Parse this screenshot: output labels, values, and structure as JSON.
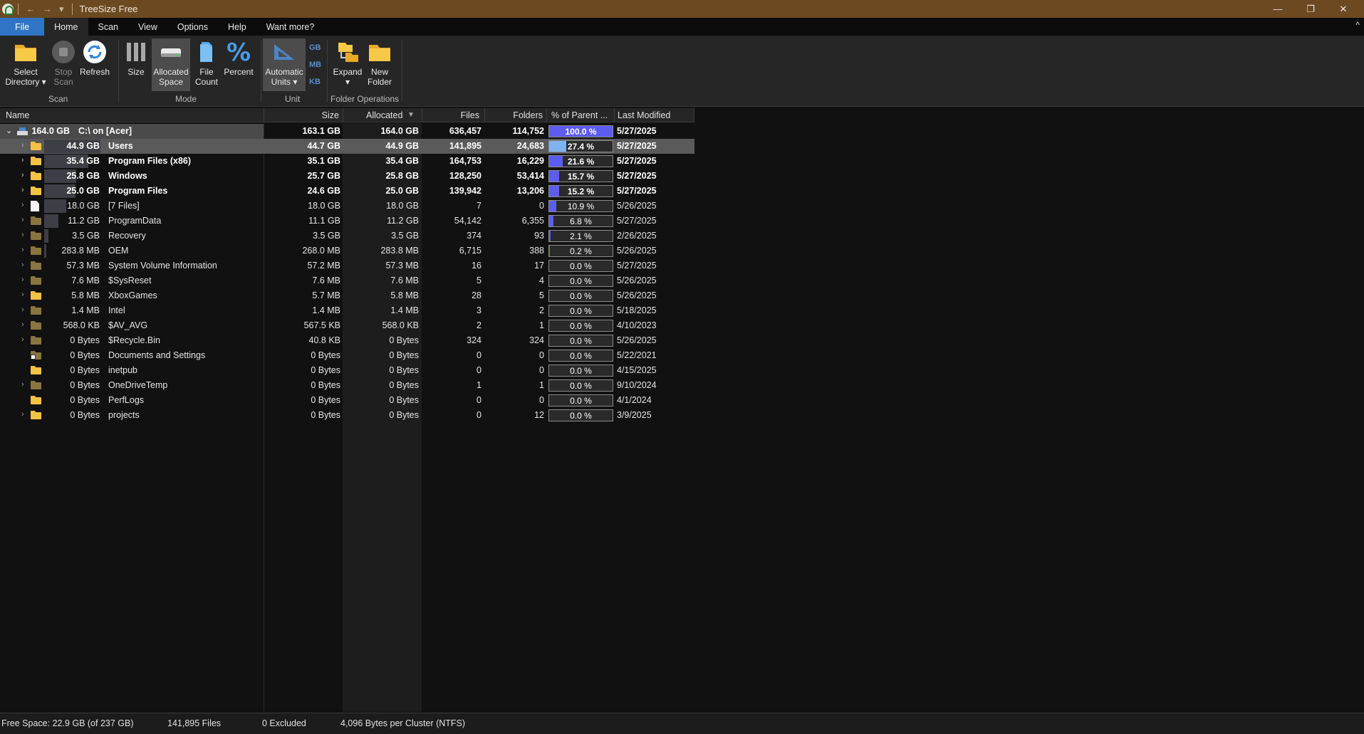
{
  "window": {
    "title": "TreeSize Free",
    "quick_access": [
      "←",
      "→",
      "▾"
    ],
    "controls": [
      "—",
      "❐",
      "✕"
    ]
  },
  "tabs": {
    "items": [
      "File",
      "Home",
      "Scan",
      "View",
      "Options",
      "Help",
      "Want more?"
    ],
    "active": "Home",
    "collapse_glyph": "^"
  },
  "ribbon": {
    "scan": {
      "label": "Scan",
      "select_directory": [
        "Select",
        "Directory ▾"
      ],
      "stop_scan": [
        "Stop",
        "Scan"
      ],
      "refresh": [
        "Refresh"
      ]
    },
    "mode": {
      "label": "Mode",
      "size": [
        "Size"
      ],
      "allocated_space": [
        "Allocated",
        "Space"
      ],
      "file_count": [
        "File",
        "Count"
      ],
      "percent": [
        "Percent"
      ]
    },
    "unit": {
      "label": "Unit",
      "automatic_units": [
        "Automatic",
        "Units ▾"
      ],
      "small_units": [
        "GB",
        "MB",
        "KB"
      ]
    },
    "folder_operations": {
      "label": "Folder Operations",
      "expand": [
        "Expand",
        "▾"
      ],
      "new_folder": [
        "New",
        "Folder"
      ]
    }
  },
  "columns": {
    "name": "Name",
    "size": "Size",
    "allocated": "Allocated",
    "files": "Files",
    "folders": "Folders",
    "percent": "% of Parent ...",
    "modified": "Last Modified",
    "sort_glyph": "▼"
  },
  "rows": [
    {
      "expander": "⌄",
      "icon": "drive",
      "alloc_label": "164.0 GB",
      "name": "C:\\  on  [Acer]",
      "size": "163.1 GB",
      "allocated": "164.0 GB",
      "files": "636,457",
      "folders": "114,752",
      "percent": 100.0,
      "percent_label": "100.0 %",
      "modified": "5/27/2025",
      "bold": true,
      "bar": 1.0
    },
    {
      "expander": "›",
      "icon": "folder",
      "alloc_label": "44.9 GB",
      "name": "Users",
      "size": "44.7 GB",
      "allocated": "44.9 GB",
      "files": "141,895",
      "folders": "24,683",
      "percent": 27.4,
      "percent_label": "27.4 %",
      "modified": "5/27/2025",
      "bold": true,
      "selected": true,
      "bar": 0.274
    },
    {
      "expander": "›",
      "icon": "folder",
      "alloc_label": "35.4 GB",
      "name": "Program Files (x86)",
      "size": "35.1 GB",
      "allocated": "35.4 GB",
      "files": "164,753",
      "folders": "16,229",
      "percent": 21.6,
      "percent_label": "21.6 %",
      "modified": "5/27/2025",
      "bold": true,
      "bar": 0.216
    },
    {
      "expander": "›",
      "icon": "folder",
      "alloc_label": "25.8 GB",
      "name": "Windows",
      "size": "25.7 GB",
      "allocated": "25.8 GB",
      "files": "128,250",
      "folders": "53,414",
      "percent": 15.7,
      "percent_label": "15.7 %",
      "modified": "5/27/2025",
      "bold": true,
      "bar": 0.157
    },
    {
      "expander": "›",
      "icon": "folder",
      "alloc_label": "25.0 GB",
      "name": "Program Files",
      "size": "24.6 GB",
      "allocated": "25.0 GB",
      "files": "139,942",
      "folders": "13,206",
      "percent": 15.2,
      "percent_label": "15.2 %",
      "modified": "5/27/2025",
      "bold": true,
      "bar": 0.152
    },
    {
      "expander": "›",
      "icon": "file",
      "alloc_label": "18.0 GB",
      "name": "[7 Files]",
      "size": "18.0 GB",
      "allocated": "18.0 GB",
      "files": "7",
      "folders": "0",
      "percent": 10.9,
      "percent_label": "10.9 %",
      "modified": "5/26/2025",
      "bold": false,
      "bar": 0.109
    },
    {
      "expander": "›",
      "icon": "folder-dim",
      "alloc_label": "11.2 GB",
      "name": "ProgramData",
      "size": "11.1 GB",
      "allocated": "11.2 GB",
      "files": "54,142",
      "folders": "6,355",
      "percent": 6.8,
      "percent_label": "6.8 %",
      "modified": "5/27/2025",
      "bold": false,
      "bar": 0.068
    },
    {
      "expander": "›",
      "icon": "folder-dim",
      "alloc_label": "3.5 GB",
      "name": "Recovery",
      "size": "3.5 GB",
      "allocated": "3.5 GB",
      "files": "374",
      "folders": "93",
      "percent": 2.1,
      "percent_label": "2.1 %",
      "modified": "2/26/2025",
      "bold": false,
      "bar": 0.021
    },
    {
      "expander": "›",
      "icon": "folder-dim",
      "alloc_label": "283.8 MB",
      "name": "OEM",
      "size": "268.0 MB",
      "allocated": "283.8 MB",
      "files": "6,715",
      "folders": "388",
      "percent": 0.2,
      "percent_label": "0.2 %",
      "modified": "5/26/2025",
      "bold": false,
      "bar": 0.002
    },
    {
      "expander": "›",
      "icon": "folder-dim",
      "alloc_label": "57.3 MB",
      "name": "System Volume Information",
      "size": "57.2 MB",
      "allocated": "57.3 MB",
      "files": "16",
      "folders": "17",
      "percent": 0.0,
      "percent_label": "0.0 %",
      "modified": "5/27/2025",
      "bold": false,
      "bar": 0
    },
    {
      "expander": "›",
      "icon": "folder-dim",
      "alloc_label": "7.6 MB",
      "name": "$SysReset",
      "size": "7.6 MB",
      "allocated": "7.6 MB",
      "files": "5",
      "folders": "4",
      "percent": 0.0,
      "percent_label": "0.0 %",
      "modified": "5/26/2025",
      "bold": false,
      "bar": 0
    },
    {
      "expander": "›",
      "icon": "folder",
      "alloc_label": "5.8 MB",
      "name": "XboxGames",
      "size": "5.7 MB",
      "allocated": "5.8 MB",
      "files": "28",
      "folders": "5",
      "percent": 0.0,
      "percent_label": "0.0 %",
      "modified": "5/26/2025",
      "bold": false,
      "bar": 0
    },
    {
      "expander": "›",
      "icon": "folder-dim",
      "alloc_label": "1.4 MB",
      "name": "Intel",
      "size": "1.4 MB",
      "allocated": "1.4 MB",
      "files": "3",
      "folders": "2",
      "percent": 0.0,
      "percent_label": "0.0 %",
      "modified": "5/18/2025",
      "bold": false,
      "bar": 0
    },
    {
      "expander": "›",
      "icon": "folder-dim",
      "alloc_label": "568.0 KB",
      "name": "$AV_AVG",
      "size": "567.5 KB",
      "allocated": "568.0 KB",
      "files": "2",
      "folders": "1",
      "percent": 0.0,
      "percent_label": "0.0 %",
      "modified": "4/10/2023",
      "bold": false,
      "bar": 0
    },
    {
      "expander": "›",
      "icon": "folder-dim",
      "alloc_label": "0 Bytes",
      "name": "$Recycle.Bin",
      "size": "40.8 KB",
      "allocated": "0 Bytes",
      "files": "324",
      "folders": "324",
      "percent": 0.0,
      "percent_label": "0.0 %",
      "modified": "5/26/2025",
      "bold": false,
      "bar": 0
    },
    {
      "expander": "",
      "icon": "folder-link",
      "alloc_label": "0 Bytes",
      "name": "Documents and Settings",
      "size": "0 Bytes",
      "allocated": "0 Bytes",
      "files": "0",
      "folders": "0",
      "percent": 0.0,
      "percent_label": "0.0 %",
      "modified": "5/22/2021",
      "bold": false,
      "bar": 0
    },
    {
      "expander": "",
      "icon": "folder",
      "alloc_label": "0 Bytes",
      "name": "inetpub",
      "size": "0 Bytes",
      "allocated": "0 Bytes",
      "files": "0",
      "folders": "0",
      "percent": 0.0,
      "percent_label": "0.0 %",
      "modified": "4/15/2025",
      "bold": false,
      "bar": 0
    },
    {
      "expander": "›",
      "icon": "folder-dim",
      "alloc_label": "0 Bytes",
      "name": "OneDriveTemp",
      "size": "0 Bytes",
      "allocated": "0 Bytes",
      "files": "1",
      "folders": "1",
      "percent": 0.0,
      "percent_label": "0.0 %",
      "modified": "9/10/2024",
      "bold": false,
      "bar": 0
    },
    {
      "expander": "",
      "icon": "folder",
      "alloc_label": "0 Bytes",
      "name": "PerfLogs",
      "size": "0 Bytes",
      "allocated": "0 Bytes",
      "files": "0",
      "folders": "0",
      "percent": 0.0,
      "percent_label": "0.0 %",
      "modified": "4/1/2024",
      "bold": false,
      "bar": 0
    },
    {
      "expander": "›",
      "icon": "folder",
      "alloc_label": "0 Bytes",
      "name": "projects",
      "size": "0 Bytes",
      "allocated": "0 Bytes",
      "files": "0",
      "folders": "12",
      "percent": 0.0,
      "percent_label": "0.0 %",
      "modified": "3/9/2025",
      "bold": false,
      "bar": 0
    }
  ],
  "status": {
    "free_space": "Free Space: 22.9 GB  (of 237 GB)",
    "files": "141,895 Files",
    "excluded": "0 Excluded",
    "cluster": "4,096 Bytes per Cluster (NTFS)"
  },
  "colors": {
    "title_bar": "#6b4a22",
    "file_tab": "#2f74c5",
    "ribbon": "#262626",
    "folder": "#f5c343",
    "folder_dim": "#8a7540",
    "pct_fill": "#5c5cf0",
    "pct_fill_selected": "#7fb3ee",
    "selected_row": "#5a5a5a"
  }
}
